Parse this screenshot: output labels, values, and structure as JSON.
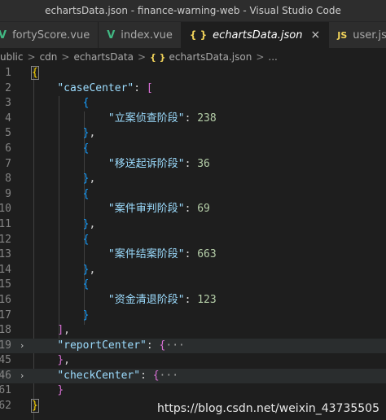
{
  "window": {
    "title": "echartsData.json - finance-warning-web - Visual Studio Code"
  },
  "tabs": [
    {
      "label": "fortyScore.vue",
      "icon": "vue-icon",
      "glyph": "V",
      "active": false
    },
    {
      "label": "index.vue",
      "icon": "vue-icon",
      "glyph": "V",
      "active": false
    },
    {
      "label": "echartsData.json",
      "icon": "json-icon",
      "glyph": "{ }",
      "active": true,
      "close": "×"
    },
    {
      "label": "user.js",
      "icon": "js-icon",
      "glyph": "JS",
      "active": false
    }
  ],
  "breadcrumb": {
    "items": [
      "ublic",
      "cdn",
      "echartsData",
      "echartsData.json",
      "..."
    ],
    "separator": ">",
    "json_glyph": "{ }"
  },
  "editor": {
    "lines": [
      {
        "num": "1",
        "tokens": [
          [
            "b1",
            "{"
          ]
        ]
      },
      {
        "num": "2",
        "tokens": [
          [
            "p",
            "    "
          ],
          [
            "k",
            "\"caseCenter\""
          ],
          [
            "p",
            ": "
          ],
          [
            "b2",
            "["
          ]
        ]
      },
      {
        "num": "3",
        "tokens": [
          [
            "p",
            "        "
          ],
          [
            "b3",
            "{"
          ]
        ]
      },
      {
        "num": "4",
        "tokens": [
          [
            "p",
            "            "
          ],
          [
            "k",
            "\"立案侦查阶段\""
          ],
          [
            "p",
            ": "
          ],
          [
            "n",
            "238"
          ]
        ]
      },
      {
        "num": "5",
        "tokens": [
          [
            "p",
            "        "
          ],
          [
            "b3",
            "}"
          ],
          [
            "p",
            ","
          ]
        ]
      },
      {
        "num": "6",
        "tokens": [
          [
            "p",
            "        "
          ],
          [
            "b3",
            "{"
          ]
        ]
      },
      {
        "num": "7",
        "tokens": [
          [
            "p",
            "            "
          ],
          [
            "k",
            "\"移送起诉阶段\""
          ],
          [
            "p",
            ": "
          ],
          [
            "n",
            "36"
          ]
        ]
      },
      {
        "num": "8",
        "tokens": [
          [
            "p",
            "        "
          ],
          [
            "b3",
            "}"
          ],
          [
            "p",
            ","
          ]
        ]
      },
      {
        "num": "9",
        "tokens": [
          [
            "p",
            "        "
          ],
          [
            "b3",
            "{"
          ]
        ]
      },
      {
        "num": "10",
        "tokens": [
          [
            "p",
            "            "
          ],
          [
            "k",
            "\"案件审判阶段\""
          ],
          [
            "p",
            ": "
          ],
          [
            "n",
            "69"
          ]
        ]
      },
      {
        "num": "11",
        "tokens": [
          [
            "p",
            "        "
          ],
          [
            "b3",
            "}"
          ],
          [
            "p",
            ","
          ]
        ]
      },
      {
        "num": "12",
        "tokens": [
          [
            "p",
            "        "
          ],
          [
            "b3",
            "{"
          ]
        ]
      },
      {
        "num": "13",
        "tokens": [
          [
            "p",
            "            "
          ],
          [
            "k",
            "\"案件结案阶段\""
          ],
          [
            "p",
            ": "
          ],
          [
            "n",
            "663"
          ]
        ]
      },
      {
        "num": "14",
        "tokens": [
          [
            "p",
            "        "
          ],
          [
            "b3",
            "}"
          ],
          [
            "p",
            ","
          ]
        ]
      },
      {
        "num": "15",
        "tokens": [
          [
            "p",
            "        "
          ],
          [
            "b3",
            "{"
          ]
        ]
      },
      {
        "num": "16",
        "tokens": [
          [
            "p",
            "            "
          ],
          [
            "k",
            "\"资金清退阶段\""
          ],
          [
            "p",
            ": "
          ],
          [
            "n",
            "123"
          ]
        ]
      },
      {
        "num": "17",
        "tokens": [
          [
            "p",
            "        "
          ],
          [
            "b3",
            "}"
          ]
        ]
      },
      {
        "num": "18",
        "tokens": [
          [
            "p",
            "    "
          ],
          [
            "b2",
            "]"
          ],
          [
            "p",
            ","
          ]
        ]
      },
      {
        "num": "19",
        "fold": "›",
        "hl": true,
        "tokens": [
          [
            "p",
            "    "
          ],
          [
            "k",
            "\"reportCenter\""
          ],
          [
            "p",
            ": "
          ],
          [
            "b2",
            "{"
          ],
          [
            "coll",
            "···"
          ]
        ]
      },
      {
        "num": "45",
        "tokens": [
          [
            "p",
            "    "
          ],
          [
            "b2",
            "}"
          ],
          [
            "p",
            ","
          ]
        ]
      },
      {
        "num": "46",
        "fold": "›",
        "hl": true,
        "tokens": [
          [
            "p",
            "    "
          ],
          [
            "k",
            "\"checkCenter\""
          ],
          [
            "p",
            ": "
          ],
          [
            "b2",
            "{"
          ],
          [
            "coll",
            "···"
          ]
        ]
      },
      {
        "num": "61",
        "tokens": [
          [
            "p",
            "    "
          ],
          [
            "b2",
            "}"
          ]
        ]
      },
      {
        "num": "62",
        "tokens": [
          [
            "b1",
            "}"
          ]
        ]
      }
    ]
  },
  "watermark": "https://blog.csdn.net/weixin_43735505"
}
